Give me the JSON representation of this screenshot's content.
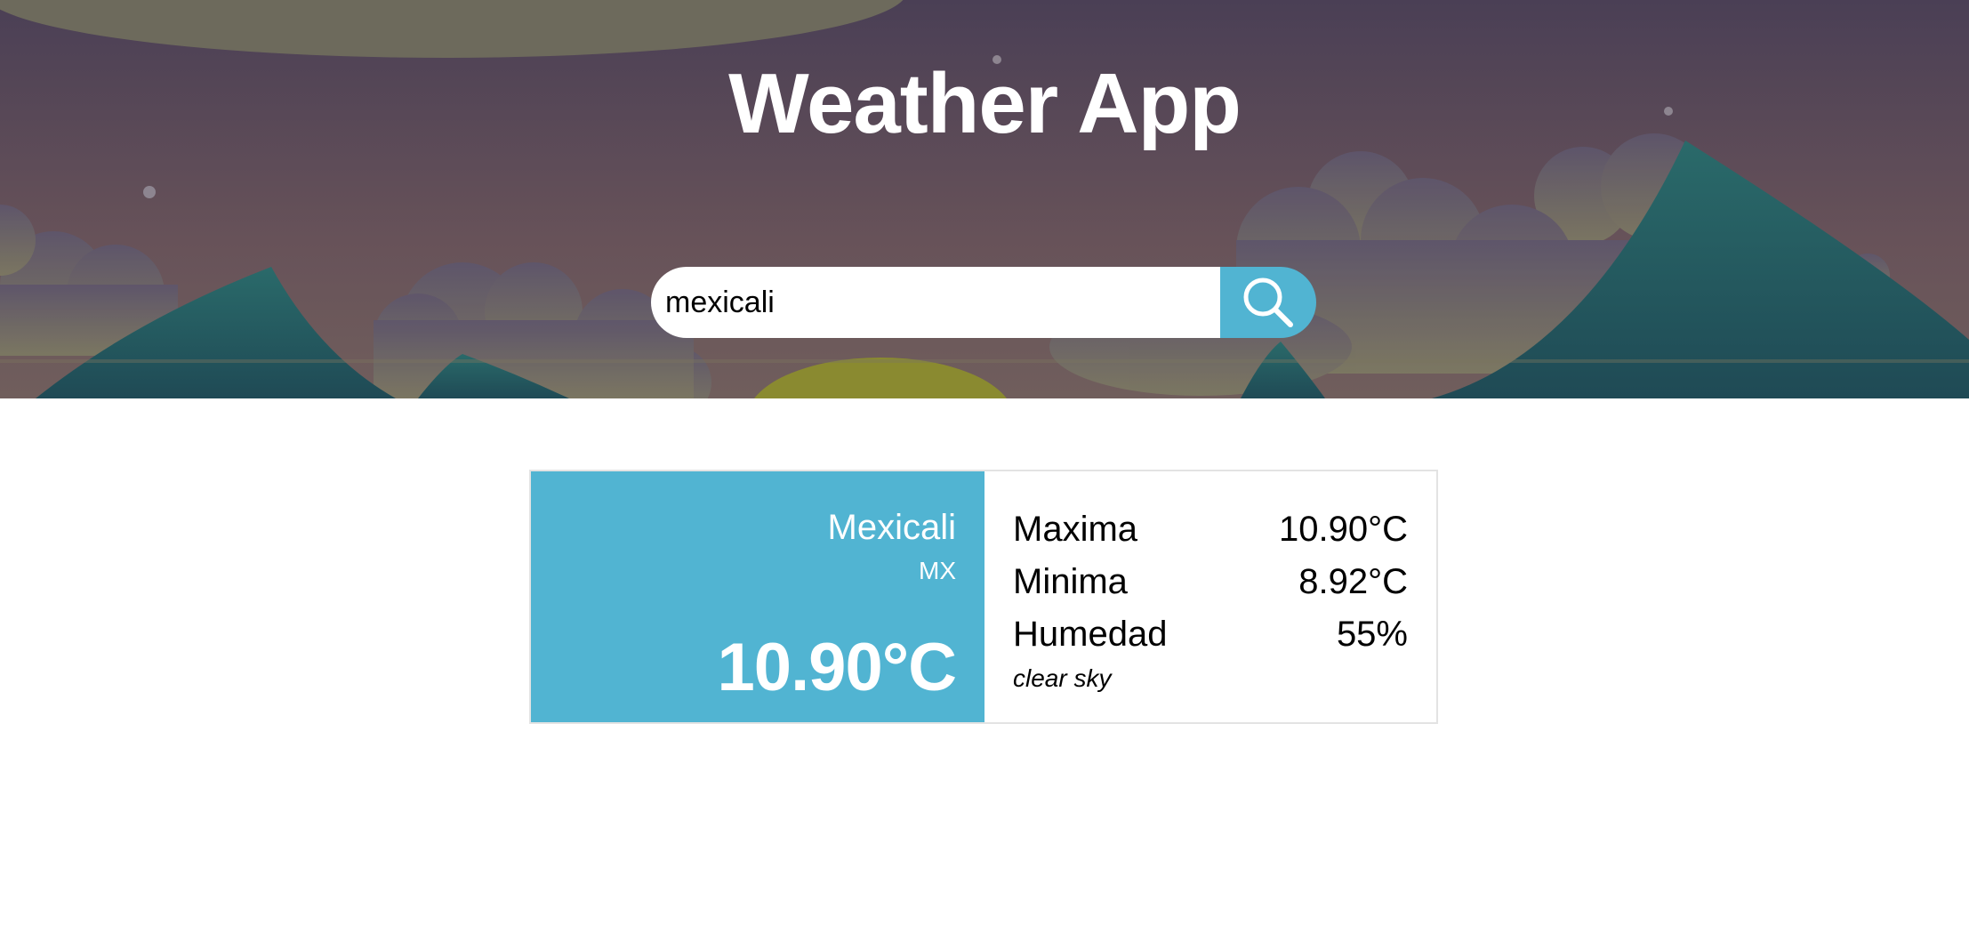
{
  "page": {
    "title": "Weather App"
  },
  "search": {
    "value": "mexicali",
    "button_icon": "search-icon"
  },
  "weather": {
    "city": "Mexicali",
    "country": "MX",
    "temperature": "10.90°C",
    "rows": [
      {
        "label": "Maxima",
        "value": "10.90°C"
      },
      {
        "label": "Minima",
        "value": "8.92°C"
      },
      {
        "label": "Humedad",
        "value": "55%"
      }
    ],
    "description": "clear sky"
  },
  "colors": {
    "accent": "#51b4d2",
    "sky_top": "#4a3f55",
    "sky_bottom": "#6e5a5e",
    "mountain": "#22545c",
    "sun": "#8a8a30",
    "card_border": "#e3e3e3"
  }
}
